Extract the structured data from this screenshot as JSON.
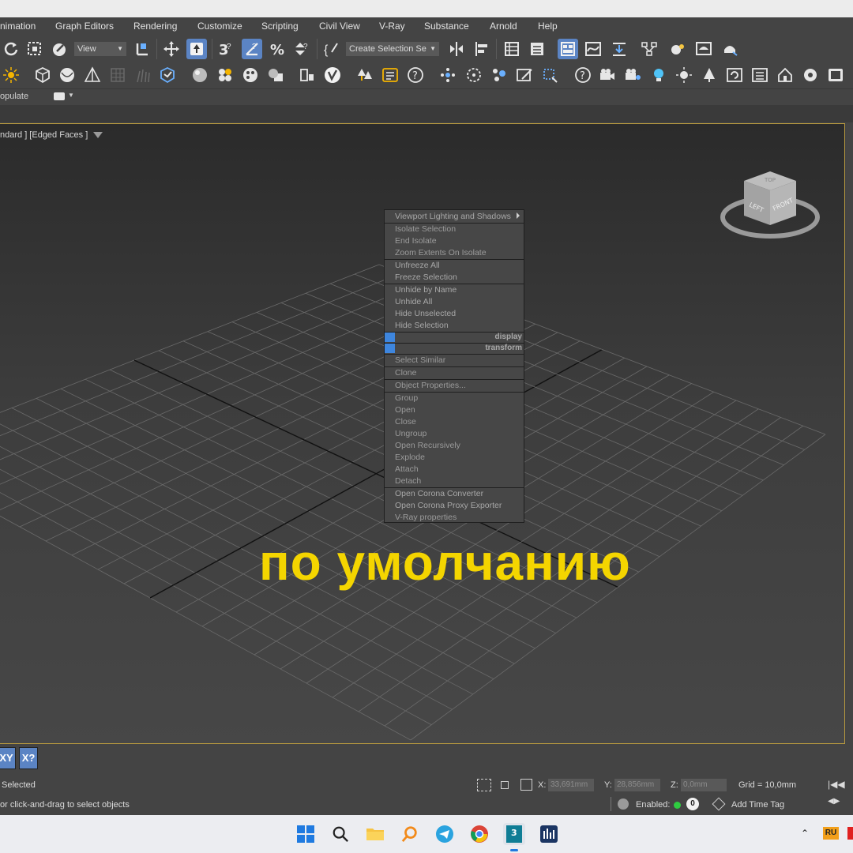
{
  "menubar": [
    "nimation",
    "Graph Editors",
    "Rendering",
    "Customize",
    "Scripting",
    "Civil View",
    "V-Ray",
    "Substance",
    "Arnold",
    "Help"
  ],
  "toolbar": {
    "view_dropdown": "View",
    "selection_set_dropdown": "Create Selection Se"
  },
  "ribbon": {
    "populate_label": "opulate"
  },
  "viewport": {
    "label": "ndard ] [Edged Faces ]",
    "viewcube": {
      "top": "TOP",
      "left": "LEFT",
      "front": "FRONT"
    }
  },
  "context_menu": {
    "groups": [
      [
        "Viewport Lighting and Shadows"
      ],
      [
        "Isolate Selection",
        "End Isolate",
        "Zoom Extents On Isolate"
      ],
      [
        "Unfreeze All",
        "Freeze Selection"
      ],
      [
        "Unhide by Name",
        "Unhide All",
        "Hide Unselected",
        "Hide Selection"
      ],
      [
        "Select Similar"
      ],
      [
        "Clone"
      ],
      [
        "Object Properties..."
      ],
      [
        "Group",
        "Open",
        "Close",
        "Ungroup",
        "Open Recursively",
        "Explode",
        "Attach",
        "Detach"
      ],
      [
        "Open Corona Converter",
        "Open Corona Proxy Exporter",
        "V-Ray properties"
      ]
    ],
    "quad_labels": {
      "display": "display",
      "transform": "transform"
    }
  },
  "overlay_caption": "по умолчанию",
  "status": {
    "xy_button": "XY",
    "xq_button": "X?",
    "selected": "Selected",
    "prompt": "or click-and-drag to select objects",
    "x_label": "X:",
    "x_value": "33,691mm",
    "y_label": "Y:",
    "y_value": "28,856mm",
    "z_label": "Z:",
    "z_value": "0,0mm",
    "grid": "Grid = 10,0mm",
    "enabled_label": "Enabled:",
    "enabled_count": "0",
    "add_time_tag": "Add Time Tag"
  },
  "taskbar": {
    "lang": "RU"
  },
  "colors": {
    "accent": "#5b84c4",
    "caption": "#f4d500",
    "viewport_border": "#b89a3f",
    "quad_blue": "#3e86de"
  }
}
